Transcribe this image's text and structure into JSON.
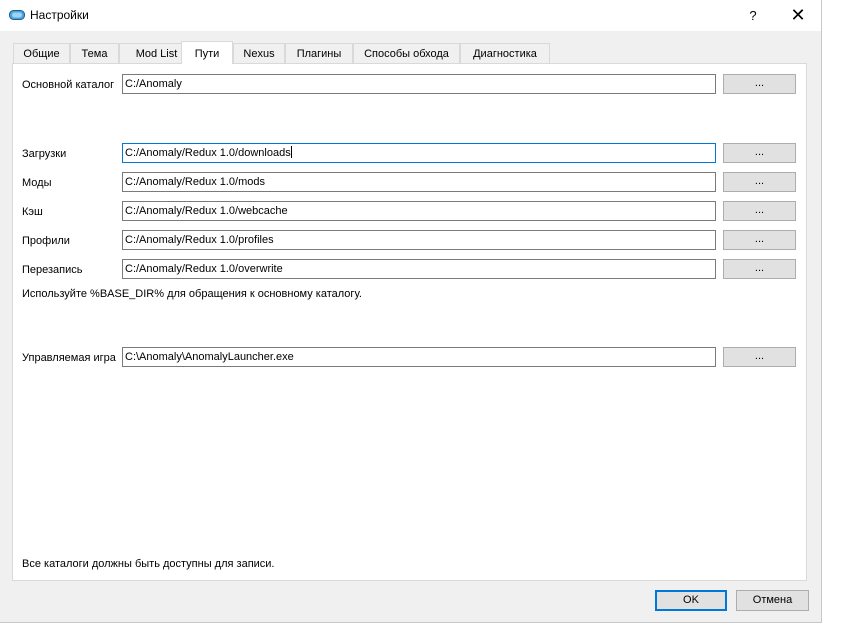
{
  "window": {
    "title": "Настройки",
    "help_label": "?",
    "close_label": "✕",
    "icon": "app-window-icon",
    "accent_color": "#0078d7"
  },
  "tabs": [
    {
      "label": "Общие"
    },
    {
      "label": "Тема"
    },
    {
      "label": "Mod List"
    },
    {
      "label": "Пути"
    },
    {
      "label": "Nexus"
    },
    {
      "label": "Плагины"
    },
    {
      "label": "Способы обхода"
    },
    {
      "label": "Диагностика"
    }
  ],
  "active_tab": "Пути",
  "paths": {
    "base": {
      "label": "Основной каталог",
      "value": "C:/Anomaly",
      "button": "..."
    },
    "downloads": {
      "label": "Загрузки",
      "value": "C:/Anomaly/Redux 1.0/downloads",
      "button": "..."
    },
    "mods": {
      "label": "Моды",
      "value": "C:/Anomaly/Redux 1.0/mods",
      "button": "..."
    },
    "cache": {
      "label": "Кэш",
      "value": "C:/Anomaly/Redux 1.0/webcache",
      "button": "..."
    },
    "profiles": {
      "label": "Профили",
      "value": "C:/Anomaly/Redux 1.0/profiles",
      "button": "..."
    },
    "overwrite": {
      "label": "Перезапись",
      "value": "C:/Anomaly/Redux 1.0/overwrite",
      "button": "..."
    },
    "base_dir_hint": "Используйте %BASE_DIR% для обращения к основному каталогу.",
    "game": {
      "label": "Управляемая игра",
      "value": "C:\\Anomaly\\AnomalyLauncher.exe",
      "button": "..."
    },
    "writable_note": "Все каталоги должны быть доступны для записи."
  },
  "footer": {
    "ok_label": "OK",
    "cancel_label": "Отмена"
  }
}
